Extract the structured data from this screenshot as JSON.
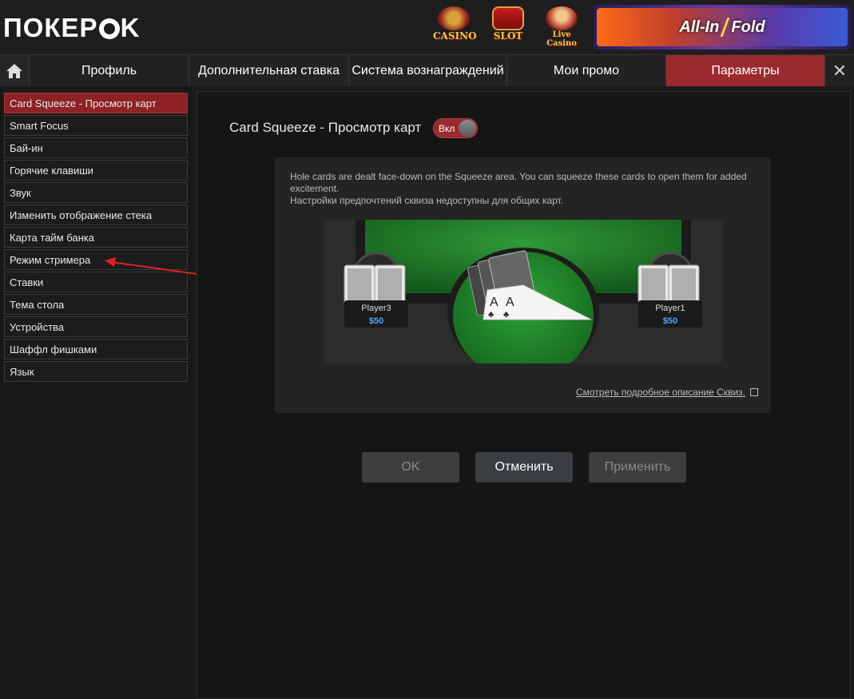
{
  "header": {
    "logo_text": "ПОКЕР",
    "logo_suffix": "K",
    "games": [
      {
        "label": "CASINO",
        "icon": "roulette-icon"
      },
      {
        "label": "SLOT",
        "icon": "slot-machine-icon"
      },
      {
        "label": "Live Casino",
        "icon": "live-dealer-icon"
      }
    ],
    "banner": {
      "left": "All-In",
      "right": "Fold"
    }
  },
  "nav": {
    "home_icon": "home-icon",
    "tabs": [
      {
        "label": "Профиль"
      },
      {
        "label": "Дополнительная ставка"
      },
      {
        "label": "Система вознаграждений"
      },
      {
        "label": "Мои промо"
      },
      {
        "label": "Параметры"
      }
    ],
    "close": "✕"
  },
  "sidebar": {
    "items": [
      {
        "label": "Card Squeeze - Просмотр карт"
      },
      {
        "label": "Smart Focus"
      },
      {
        "label": "Бай-ин"
      },
      {
        "label": "Горячие клавиши"
      },
      {
        "label": "Звук"
      },
      {
        "label": "Изменить отображение стека"
      },
      {
        "label": "Карта тайм банка"
      },
      {
        "label": "Режим стримера"
      },
      {
        "label": "Ставки"
      },
      {
        "label": "Тема стола"
      },
      {
        "label": "Устройства"
      },
      {
        "label": "Шаффл фишками"
      },
      {
        "label": "Язык"
      }
    ],
    "active_index": 0
  },
  "main": {
    "title": "Card Squeeze - Просмотр карт",
    "toggle_label": "Вкл",
    "info_line1": "Hole cards are dealt face-down on the Squeeze area. You can squeeze these cards to open them for added excitement.",
    "info_line2": "Настройки предпочтений сквиза недоступны для общих карт.",
    "players": [
      {
        "name": "Player3",
        "stack": "$50"
      },
      {
        "name": "Player1",
        "stack": "$50"
      }
    ],
    "card_rank": "A",
    "link": "Смотреть подробное описание Сквиз."
  },
  "buttons": {
    "ok": "OK",
    "cancel": "Отменить",
    "apply": "Применить"
  },
  "colors": {
    "accent_red": "#9a2a2e",
    "table_green": "#1f7a2a",
    "stack_blue": "#4aa8ff"
  }
}
